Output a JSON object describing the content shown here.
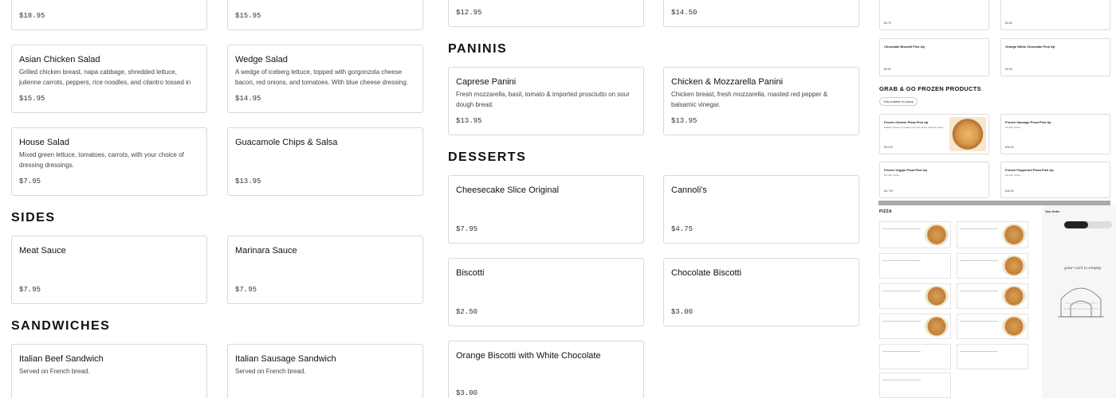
{
  "top_row": [
    {
      "price": "$18.95"
    },
    {
      "price": "$15.95"
    },
    {
      "price": "$12.95"
    },
    {
      "price": "$14.50"
    }
  ],
  "salads": [
    {
      "title": "Asian Chicken Salad",
      "desc": "Grilled chicken breast, napa cabbage, shredded lettuce, julienne carrots, peppers, rice noodles, and cilantro tossed in",
      "price": "$15.95"
    },
    {
      "title": "Wedge Salad",
      "desc": "A wedge of iceberg lettuce, topped with gorgonzola cheese bacon, red onions, and tomatoes. With blue cheese dressing.",
      "price": "$14.95"
    },
    {
      "title": "House Salad",
      "desc": "Mixed green lettuce, tomatoes, carrots, with your choice of dressing dressings.",
      "price": "$7.95"
    },
    {
      "title": "Guacamole Chips & Salsa",
      "desc": "",
      "price": "$13.95"
    }
  ],
  "sections": {
    "sides": "SIDES",
    "sandwiches": "SANDWICHES",
    "paninis": "PANINIS",
    "desserts": "DESSERTS"
  },
  "sides": [
    {
      "title": "Meat Sauce",
      "price": "$7.95"
    },
    {
      "title": "Marinara Sauce",
      "price": "$7.95"
    }
  ],
  "sandwiches": [
    {
      "title": "Italian Beef Sandwich",
      "desc": "Served on French bread."
    },
    {
      "title": "Italian Sausage Sandwich",
      "desc": "Served on French bread."
    }
  ],
  "paninis": [
    {
      "title": "Caprese Panini",
      "desc": "Fresh mozzarella, basil, tomato & imported prosciutto on sour dough bread.",
      "price": "$13.95"
    },
    {
      "title": "Chicken & Mozzarella Panini",
      "desc": "Chicken breast, fresh mozzarella, roasted red pepper & balsamic vinegar.",
      "price": "$13.95"
    }
  ],
  "desserts": [
    {
      "title": "Cheesecake Slice Original",
      "price": "$7.95"
    },
    {
      "title": "Cannoli's",
      "price": "$4.75"
    },
    {
      "title": "Biscotti",
      "price": "$2.50"
    },
    {
      "title": "Chocolate Biscotti",
      "price": "$3.00"
    },
    {
      "title": "Orange Biscotti with White Chocolate",
      "price": "$3.00"
    }
  ],
  "thumbnail": {
    "top_cards": [
      {
        "title": "",
        "price": "$4.75"
      },
      {
        "title": "",
        "price": "$3.50"
      },
      {
        "title": "Chocolate Biscotti Pick Up",
        "price": "$4.00"
      },
      {
        "title": "Orange White Chocolate Pick Up",
        "price": "$4.00"
      }
    ],
    "frozen_heading": "GRAB & GO FROZEN PRODUCTS",
    "pickup_chip": "Only available for pickup",
    "frozen": [
      {
        "title": "Frozen Cheese Pizza Pick Up",
        "desc": "Classic cheese or create your own pizza. 24 hour notice.",
        "price": "$14.00"
      },
      {
        "title": "Frozen Sausage Pizza Pick Up",
        "desc": "24 hour notice.",
        "price": "$16.00"
      },
      {
        "title": "Frozen Veggie Pizza Pick Up",
        "desc": "24 hour notice.",
        "price": "$17.00"
      },
      {
        "title": "Frozen Pepperoni Pizza Pick Up",
        "desc": "24 hour notice.",
        "price": "$16.00"
      }
    ],
    "pizza_heading": "PIZZA",
    "order_title": "Your Order",
    "cart_empty": "your cart is empty"
  }
}
